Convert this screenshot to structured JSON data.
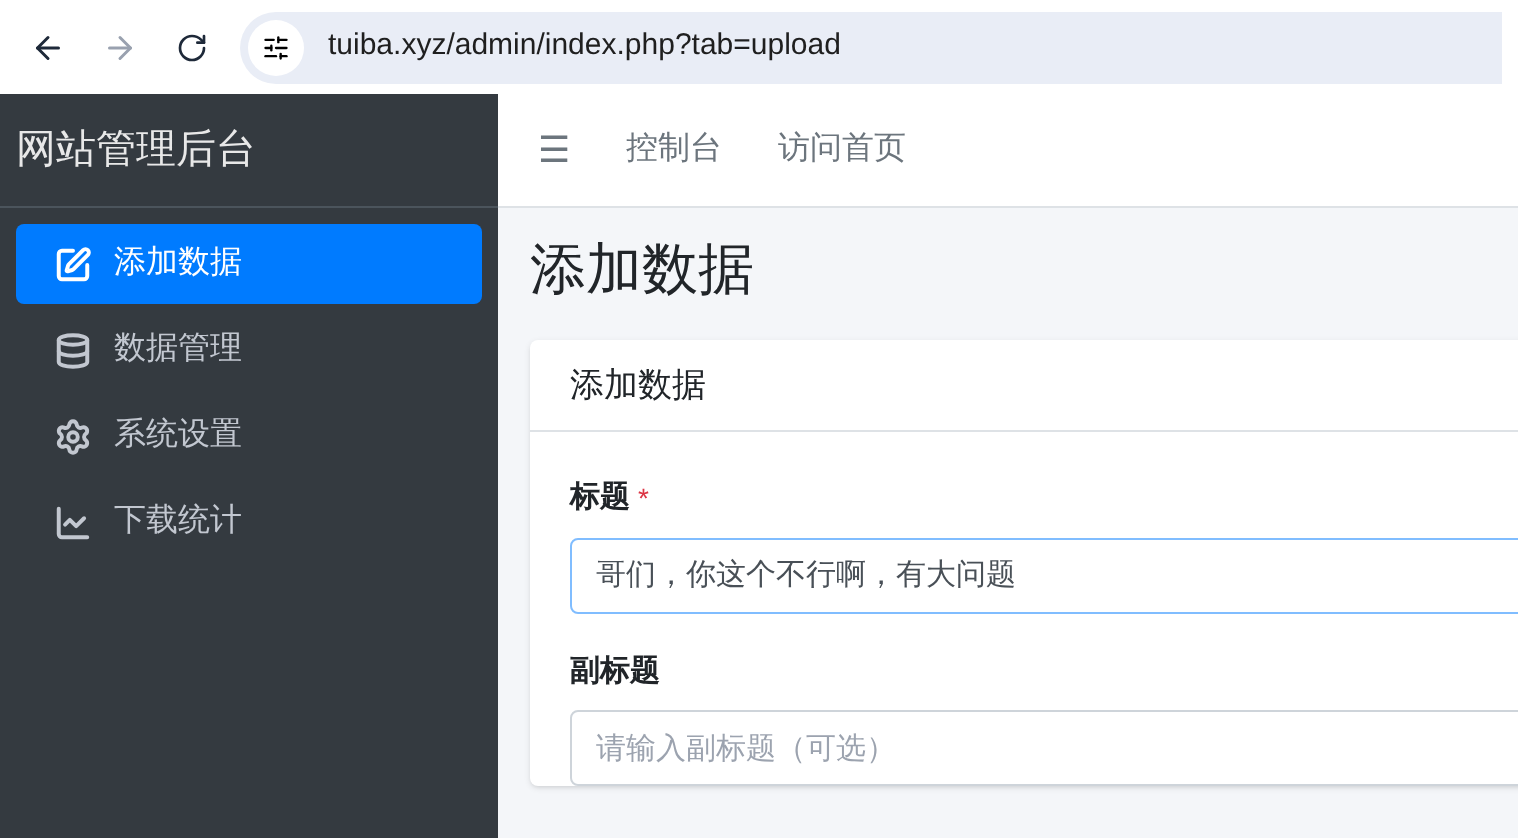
{
  "browser": {
    "url": "tuiba.xyz/admin/index.php?tab=upload",
    "back_disabled": false,
    "forward_disabled": true
  },
  "sidebar": {
    "brand": "网站管理后台",
    "items": [
      {
        "label": "添加数据",
        "selected": true
      },
      {
        "label": "数据管理",
        "selected": false
      },
      {
        "label": "系统设置",
        "selected": false
      },
      {
        "label": "下载统计",
        "selected": false
      }
    ]
  },
  "topnav": {
    "menu_icon": "☰",
    "links": [
      "控制台",
      "访问首页"
    ]
  },
  "page_title": "添加数据",
  "card": {
    "title": "添加数据",
    "fields": [
      {
        "label": "标题",
        "required_mark": "*",
        "value": "哥们，你这个不行啊，有大问题",
        "focused": true
      },
      {
        "label": "副标题",
        "placeholder": "请输入副标题（可选）",
        "focused": false
      }
    ]
  }
}
